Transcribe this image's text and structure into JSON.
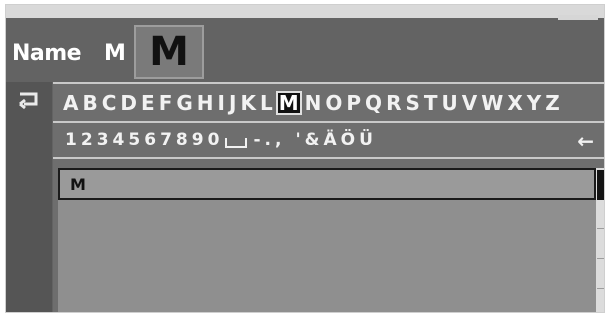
{
  "header": {
    "name_label": "Name",
    "name_value": "M",
    "preview_char": "M"
  },
  "keyboard": {
    "letters": [
      "A",
      "B",
      "C",
      "D",
      "E",
      "F",
      "G",
      "H",
      "I",
      "J",
      "K",
      "L",
      "M",
      "N",
      "O",
      "P",
      "Q",
      "R",
      "S",
      "T",
      "U",
      "V",
      "W",
      "X",
      "Y",
      "Z"
    ],
    "selected_letter": "M",
    "symbols": [
      "1",
      "2",
      "3",
      "4",
      "5",
      "6",
      "7",
      "8",
      "9",
      "0",
      "space",
      "-",
      ".",
      ",",
      "'",
      "&",
      "Ä",
      "Ö",
      "Ü"
    ],
    "delete_icon": "←"
  },
  "input": {
    "value": "M"
  },
  "icons": {
    "back": "back-arrow-icon",
    "space": "space-icon",
    "delete": "delete-icon"
  },
  "colors": {
    "background": "#636363",
    "selected_key_bg": "#111111"
  }
}
